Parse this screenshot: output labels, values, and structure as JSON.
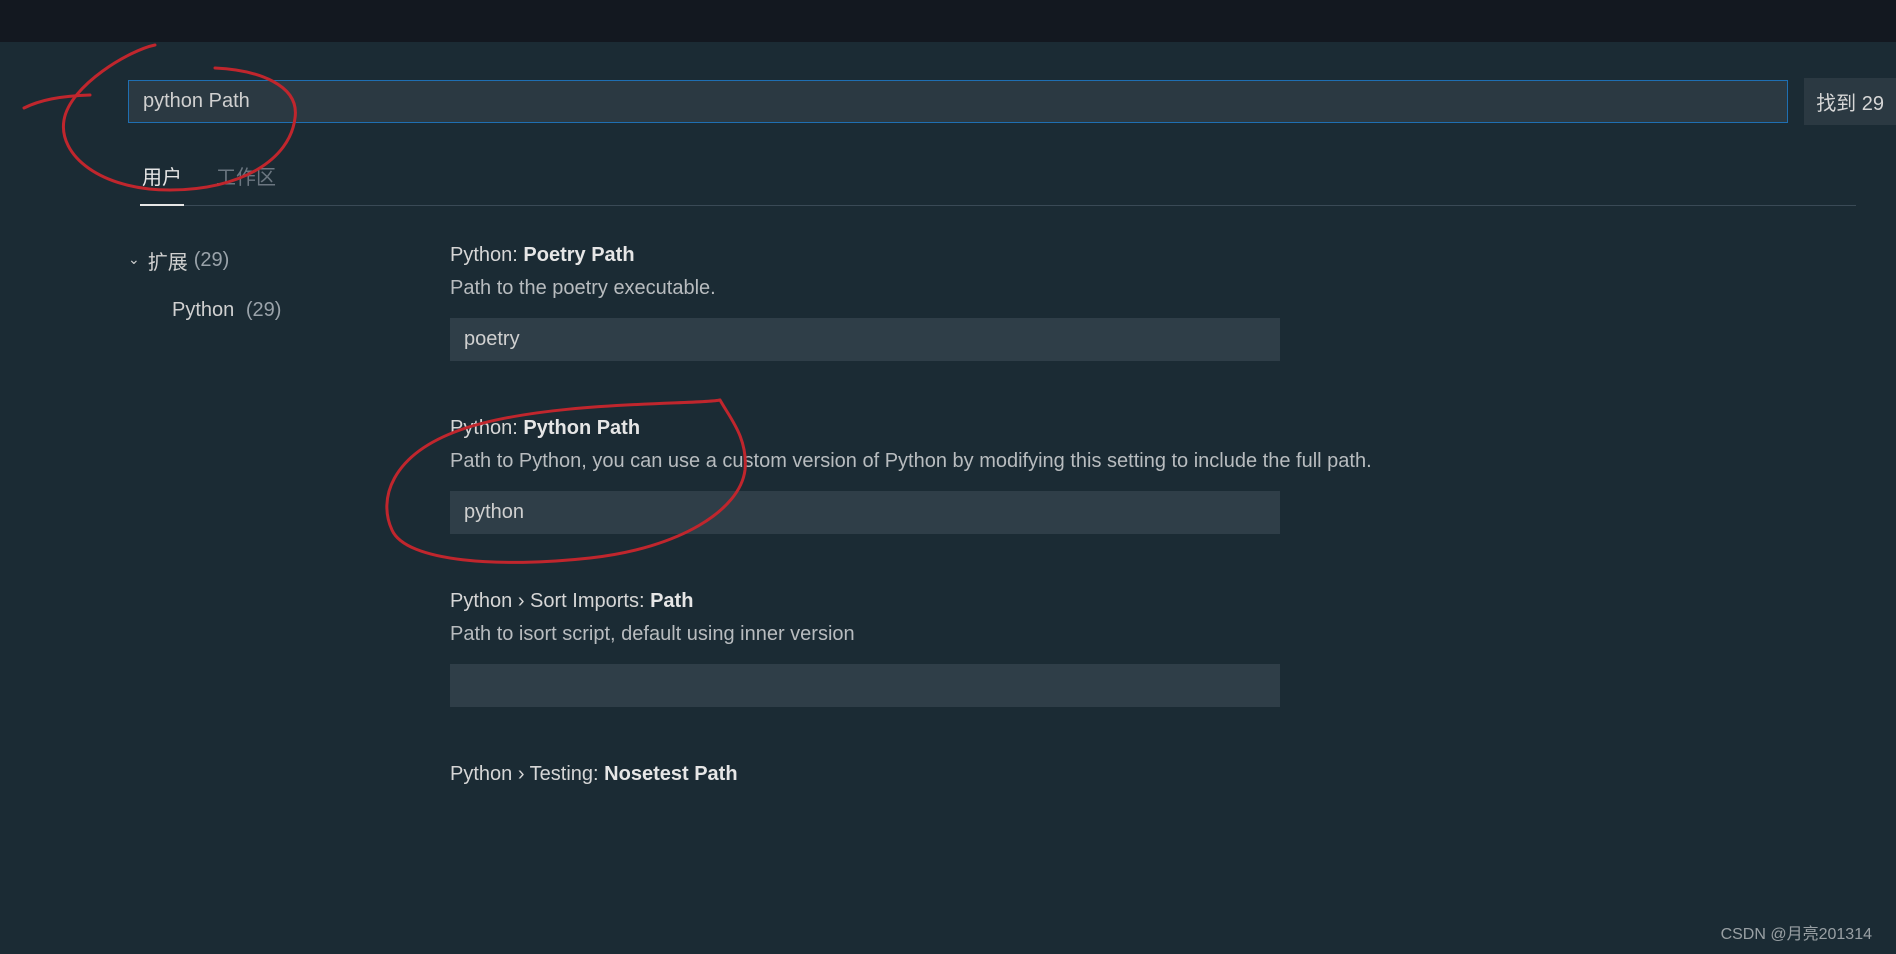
{
  "search": {
    "value": "python Path",
    "result_label": "找到 29"
  },
  "tabs": {
    "user": "用户",
    "workspace": "工作区"
  },
  "sidebar": {
    "extensions_label": "扩展",
    "extensions_count": "(29)",
    "python_label": "Python",
    "python_count": "(29)"
  },
  "settings": [
    {
      "category": "Python: ",
      "name": "Poetry Path",
      "description": "Path to the poetry executable.",
      "value": "poetry"
    },
    {
      "category": "Python: ",
      "name": "Python Path",
      "description": "Path to Python, you can use a custom version of Python by modifying this setting to include the full path.",
      "value": "python"
    },
    {
      "category": "Python › Sort Imports: ",
      "name": "Path",
      "description": "Path to isort script, default using inner version",
      "value": ""
    },
    {
      "category": "Python › Testing: ",
      "name": "Nosetest Path",
      "description": "",
      "value": ""
    }
  ],
  "watermark": "CSDN @月亮201314",
  "colors": {
    "accent": "#1f6fb2",
    "ink": "#c0262d"
  }
}
